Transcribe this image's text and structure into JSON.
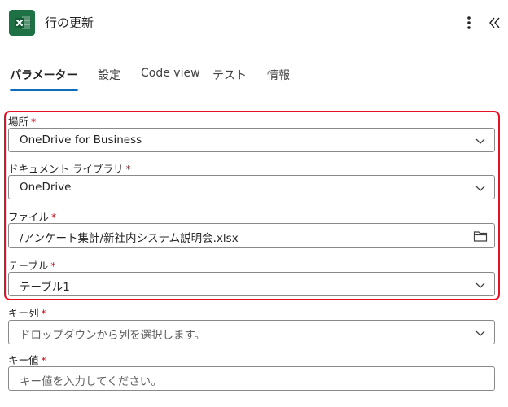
{
  "header": {
    "title": "行の更新",
    "app_icon": "excel-icon",
    "accent": "#1e7145"
  },
  "tabs": [
    {
      "label": "パラメーター",
      "active": true
    },
    {
      "label": "設定",
      "active": false
    },
    {
      "label": "Code view",
      "active": false
    },
    {
      "label": "テスト",
      "active": false
    },
    {
      "label": "情報",
      "active": false
    }
  ],
  "fields": {
    "location": {
      "label": "場所",
      "required": "*",
      "value": "OneDrive for Business"
    },
    "library": {
      "label": "ドキュメント ライブラリ",
      "required": "*",
      "value": "OneDrive"
    },
    "file": {
      "label": "ファイル",
      "required": "*",
      "value": "/アンケート集計/新社内システム説明会.xlsx"
    },
    "table": {
      "label": "テーブル",
      "required": "*",
      "value": "テーブル1"
    },
    "key_column": {
      "label": "キー列",
      "required": "*",
      "placeholder": "ドロップダウンから列を選択します。"
    },
    "key_value": {
      "label": "キー値",
      "required": "*",
      "placeholder": "キー値を入力してください。"
    }
  },
  "colors": {
    "tab_underline": "#0f6cbd",
    "highlight_border": "#e81123",
    "required_mark": "#c50f1f"
  }
}
